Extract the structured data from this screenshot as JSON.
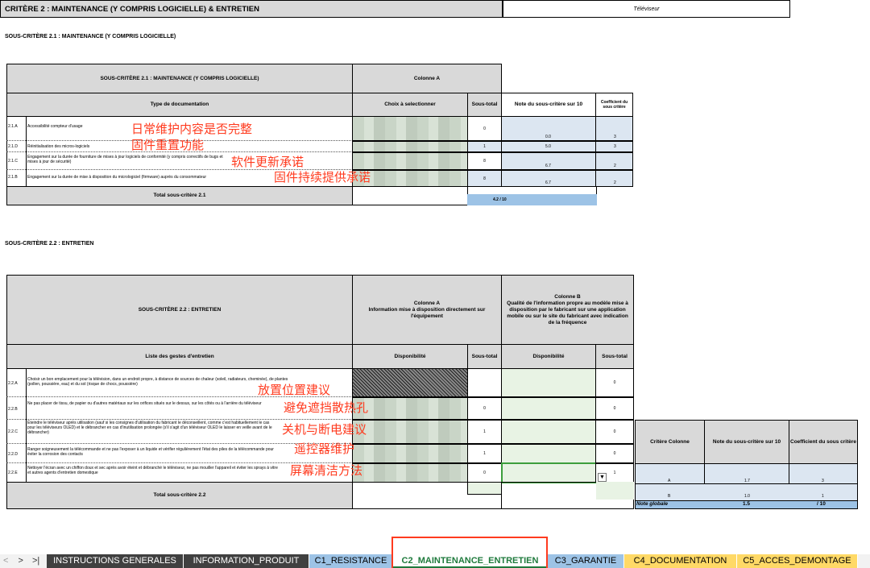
{
  "header": {
    "title": "CRITÈRE 2 : MAINTENANCE (Y COMPRIS LOGICIELLE) & ENTRETIEN",
    "product": "Téléviseur"
  },
  "section1": {
    "heading": "SOUS-CRITÈRE 2.1 : MAINTENANCE (Y COMPRIS LOGICIELLE)",
    "table_title": "SOUS-CRITÈRE 2.1 : MAINTENANCE (Y COMPRIS LOGICIELLE)",
    "col_a": "Colonne A",
    "type_header": "Type de documentation",
    "choice_header": "Choix à selectionner",
    "subtotal_header": "Sous-total",
    "note_header": "Note du sous-critère sur 10",
    "coef_header": "Coefficient du sous critère",
    "rows": [
      {
        "code": "2.1.A",
        "label": "Accessibilité compteur d'usage",
        "subtotal": "0",
        "note": "0.0",
        "coef": "3"
      },
      {
        "code": "2.1.D",
        "label": "Réinitialisation des micros-logiciels",
        "subtotal": "1",
        "note": "5.0",
        "coef": "3"
      },
      {
        "code": "2.1.C",
        "label": "Engagement sur la durée de fourniture de mises à jour logiciels de conformité (y compris correctifs de bugs et mises à jour de sécurité)",
        "subtotal": "8",
        "note": "6.7",
        "coef": "2"
      },
      {
        "code": "2.1.B",
        "label": "Engagement sur la durée de mise à disposition du micrologiciel (firmware) auprès du consommateur",
        "subtotal": "8",
        "note": "6.7",
        "coef": "2"
      }
    ],
    "total_label": "Total sous-critère 2.1",
    "total_value": "4.2 / 10",
    "annotations": [
      "日常维护内容是否完整",
      "固件重置功能",
      "软件更新承诺",
      "固件持续提供承诺"
    ]
  },
  "section2": {
    "heading": "SOUS-CRITÈRE 2.2 : ENTRETIEN",
    "table_title": "SOUS-CRITÈRE 2.2 : ENTRETIEN",
    "col_a": "Colonne A\nInformation mise à disposition directement sur l'équipement",
    "col_b": "Colonne B\nQualité de l'information propre au modèle mise à disposition par le fabricant sur une application mobile ou sur le site du fabricant avec indication de la fréquence",
    "list_header": "Liste des gestes d'entretien",
    "dispo_header": "Disponibilité",
    "subtotal_header": "Sous-total",
    "dispo_header_b": "Disponibilité",
    "subtotal_header_b": "Sous-total",
    "rows": [
      {
        "code": "2.2.A",
        "label": "Choisir un bon emplacement pour la télévision, dans un endroit propre, à distance de sources de chaleur (soleil, radiateurs, cheminée), de plantes (pollen, poussière, eau) et du sol (risque de chocs, poussière)",
        "sub_a": "",
        "sub_b": "0"
      },
      {
        "code": "2.2.B",
        "label": "Ne pas placer de tissu, de papier ou d'autres matériaux sur les orifices situés sur le dessus, sur les côtés ou à l'arrière du téléviseur",
        "sub_a": "0",
        "sub_b": "0"
      },
      {
        "code": "2.2.C",
        "label": "Éteindre le téléviseur après utilisation (sauf si les consignes d'utilisation du fabricant le déconseillent, comme c'est habituellement le cas pour les téléviseurs OLED) et le débrancher en cas d'inutilisation prolongée (s'il s'agit d'un téléviseur OLED le laisser en veille avant de le débrancher)",
        "sub_a": "1",
        "sub_b": "0"
      },
      {
        "code": "2.2.D",
        "label": "Ranger soigneusement la télécommande et ne pas l'exposer à un liquide et vérifier régulièrement l'état des piles de la télécommande pour éviter la corrosion des contacts",
        "sub_a": "1",
        "sub_b": "0"
      },
      {
        "code": "2.2.E",
        "label": "Nettoyer l'écran avec un chiffon doux et sec après avoir éteint et débranché le téléviseur, ne pas mouiller l'appareil et éviter les sprays à vitre et autres agents d'entretien domestique",
        "sub_a": "0",
        "sub_b": "1"
      }
    ],
    "total_label": "Total sous-critère 2.2",
    "annotations": [
      "放置位置建议",
      "避免遮挡散热孔",
      "关机与断电建议",
      "遥控器维护",
      "屏幕清洁方法"
    ]
  },
  "summary": {
    "col1": "Critère Colonne",
    "col2": "Note du sous-critère sur 10",
    "col3": "Coefficient du sous critère",
    "rows": [
      {
        "c": "A",
        "note": "1.7",
        "coef": "3"
      },
      {
        "c": "B",
        "note": "1.0",
        "coef": "1"
      }
    ],
    "global_label": "Note globale",
    "global_note": "1.5",
    "global_max": "/ 10"
  },
  "tabs": {
    "nav": [
      "<",
      ">",
      ">|"
    ],
    "items": [
      {
        "label": "INSTRUCTIONS GENERALES",
        "color": "#404040"
      },
      {
        "label": "INFORMATION_PRODUIT",
        "color": "#404040"
      },
      {
        "label": "C1_RESISTANCE",
        "color": "#9dc3e6"
      },
      {
        "label": "C2_MAINTENANCE_ENTRETIEN",
        "color": "#ffffff",
        "active": true
      },
      {
        "label": "C3_GARANTIE",
        "color": "#9dc3e6"
      },
      {
        "label": "C4_DOCUMENTATION",
        "color": "#ffd966"
      },
      {
        "label": "C5_ACCES_DEMONTAGE",
        "color": "#ffd966"
      }
    ]
  }
}
